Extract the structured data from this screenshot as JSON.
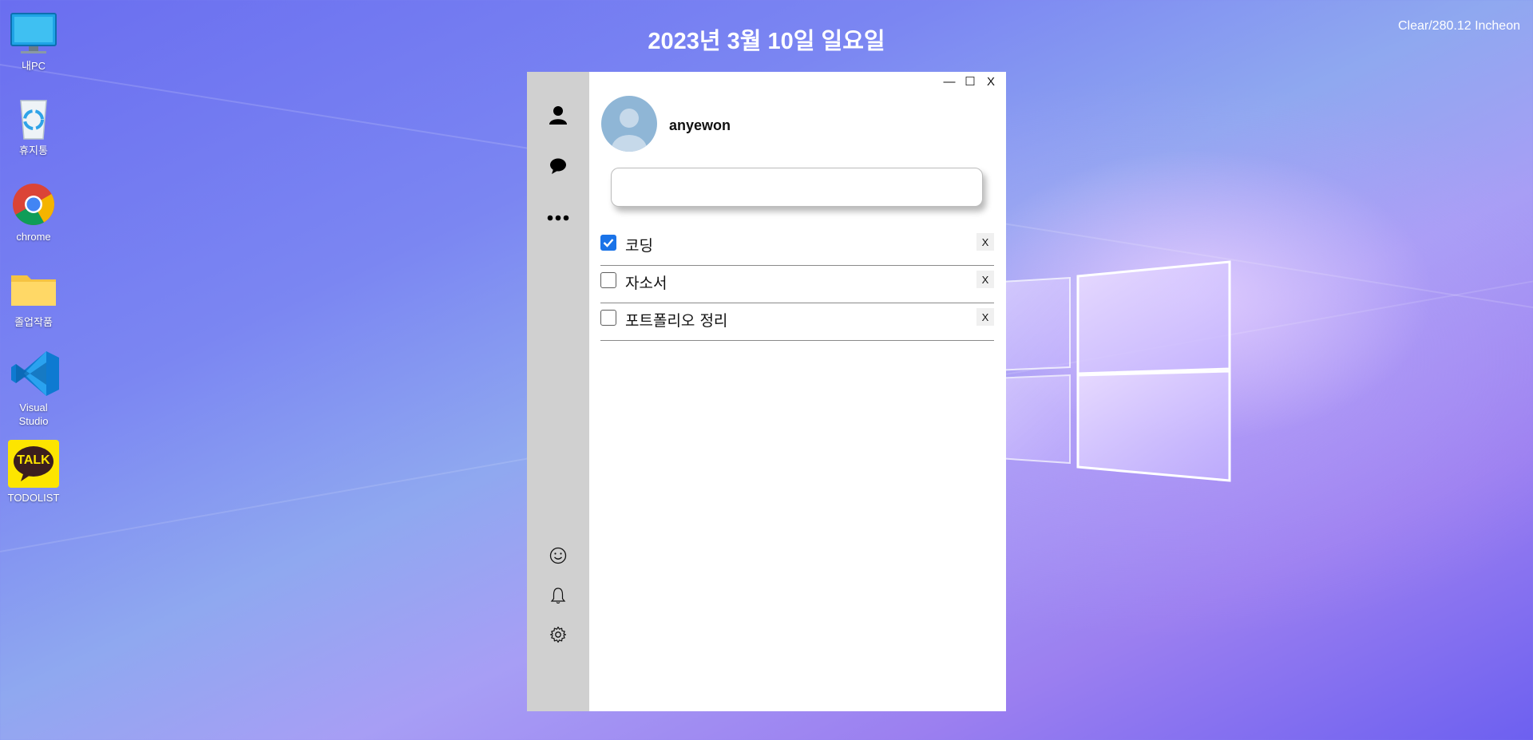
{
  "header": {
    "date": "2023년 3월 10일 일요일",
    "weather": "Clear/280.12 Incheon"
  },
  "desktop_icons": [
    {
      "label": "내PC",
      "icon": "monitor-icon"
    },
    {
      "label": "휴지통",
      "icon": "recycle-bin-icon"
    },
    {
      "label": "chrome",
      "icon": "chrome-icon"
    },
    {
      "label": "졸업작품",
      "icon": "folder-icon"
    },
    {
      "label": "Visual Studio",
      "icon": "vscode-icon"
    },
    {
      "label": "TODOLIST",
      "icon": "kakaotalk-icon",
      "badge": "TALK"
    }
  ],
  "window": {
    "controls": {
      "minimize": "—",
      "maximize": "☐",
      "close": "X"
    }
  },
  "sidebar": {
    "top_items": [
      "person-icon",
      "chat-bubble-icon",
      "more-dots-icon"
    ],
    "bottom_items": [
      "smiley-icon",
      "bell-icon",
      "gear-icon"
    ]
  },
  "profile": {
    "name": "anyewon"
  },
  "todo_input": {
    "value": "",
    "placeholder": ""
  },
  "todos": [
    {
      "text": "코딩",
      "done": true,
      "delete_label": "X"
    },
    {
      "text": "자소서",
      "done": false,
      "delete_label": "X"
    },
    {
      "text": "포트폴리오 정리",
      "done": false,
      "delete_label": "X"
    }
  ],
  "colors": {
    "checkbox_checked": "#1a73e8",
    "sidebar_bg": "#d0d0d0",
    "avatar_bg": "#8fb6d6"
  }
}
